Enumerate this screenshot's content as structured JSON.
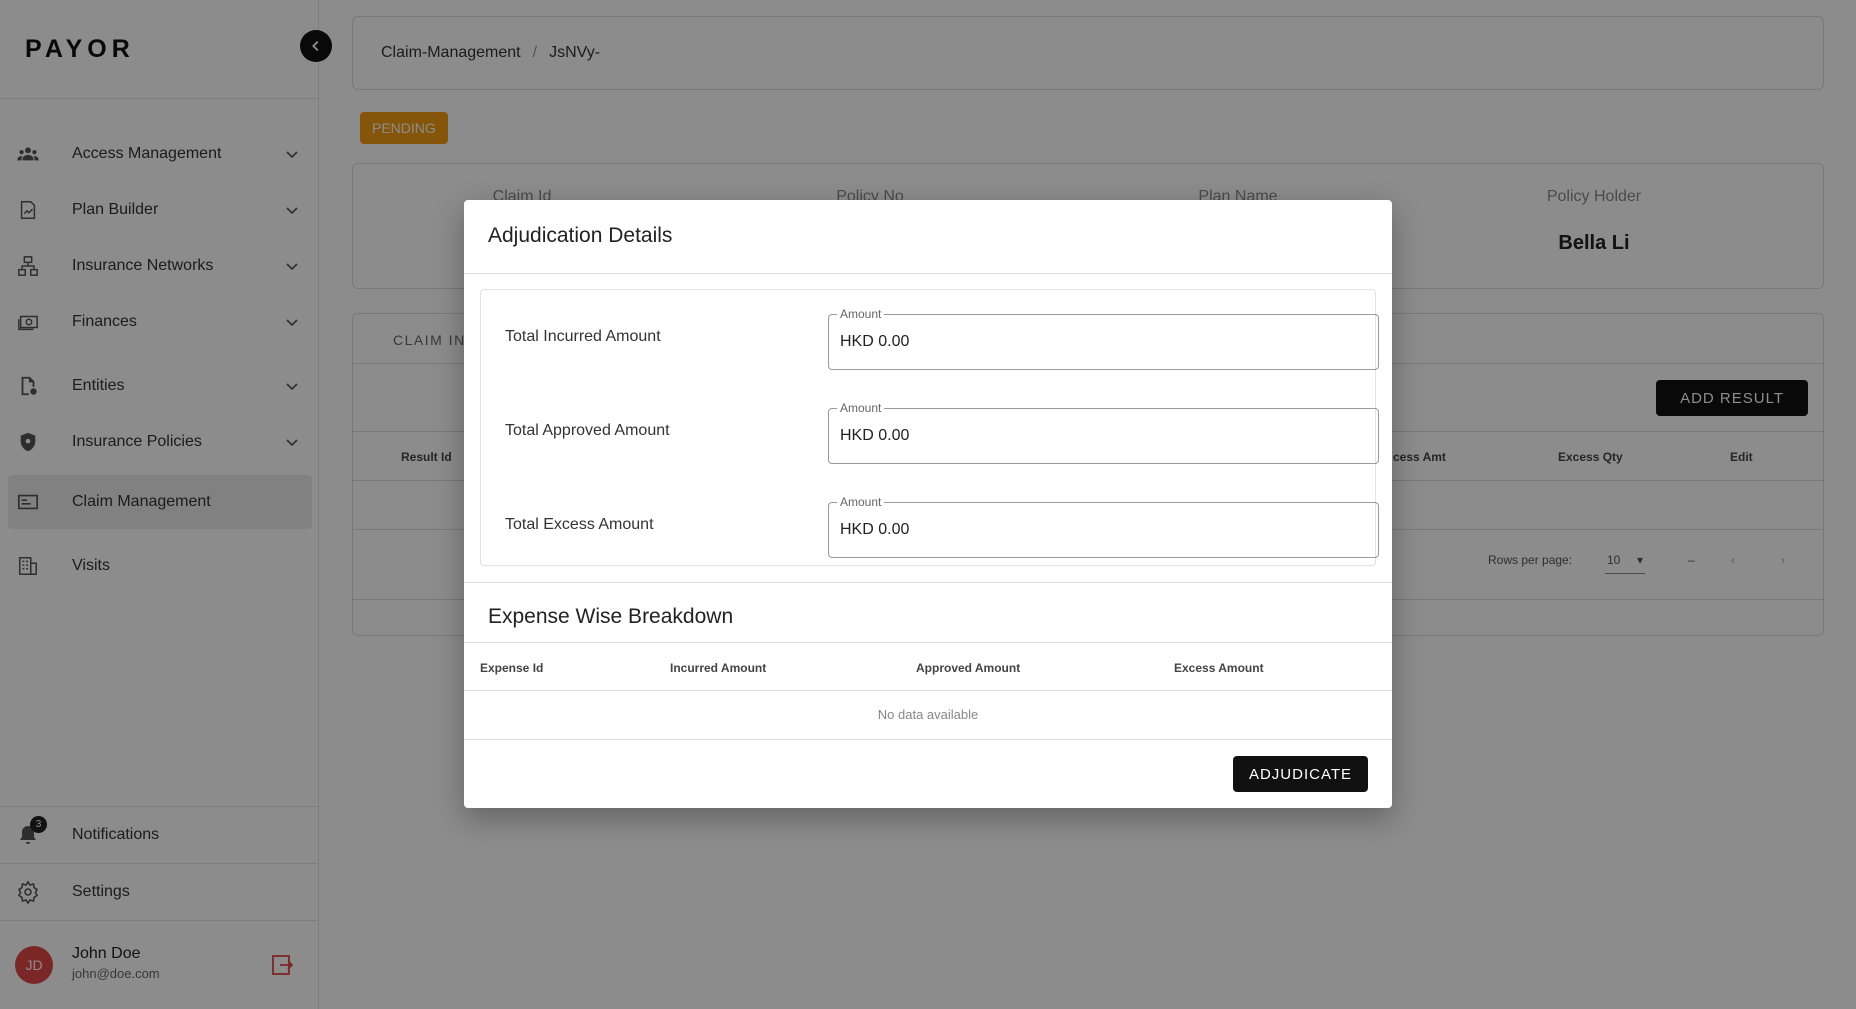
{
  "app": {
    "logo": "PAYOR"
  },
  "sidebar": {
    "items": [
      {
        "label": "Access Management",
        "icon": "users-icon"
      },
      {
        "label": "Plan Builder",
        "icon": "plan-icon"
      },
      {
        "label": "Insurance Networks",
        "icon": "network-icon"
      },
      {
        "label": "Finances",
        "icon": "money-icon"
      },
      {
        "label": "Entities",
        "icon": "entity-icon"
      },
      {
        "label": "Insurance Policies",
        "icon": "shield-icon"
      },
      {
        "label": "Claim Management",
        "icon": "card-icon",
        "active": true
      },
      {
        "label": "Visits",
        "icon": "building-icon"
      }
    ],
    "notifications": {
      "label": "Notifications",
      "count": "3"
    },
    "settings": {
      "label": "Settings"
    },
    "user": {
      "initials": "JD",
      "name": "John Doe",
      "email": "john@doe.com"
    }
  },
  "breadcrumb": {
    "first": "Claim-Management",
    "separator": "/",
    "second": "JsNVy-"
  },
  "status": {
    "label": "PENDING",
    "color": "#f39c12"
  },
  "info": {
    "claim_id_label": "Claim Id",
    "policy_no_label": "Policy No",
    "plan_name_label": "Plan Name",
    "policy_holder_label": "Policy Holder",
    "policy_holder_value": "Bella Li"
  },
  "tabs": {
    "active_label": "CLAIM IN"
  },
  "results": {
    "add_button": "ADD RESULT",
    "columns": {
      "result_id": "Result Id",
      "excess_amt": "cess Amt",
      "excess_qty": "Excess Qty",
      "edit": "Edit"
    },
    "pager": {
      "rows_label": "Rows per page:",
      "rows_value": "10",
      "range": "–"
    }
  },
  "modal": {
    "title": "Adjudication Details",
    "amounts": [
      {
        "label": "Total Incurred Amount",
        "legend": "Amount",
        "value": "HKD 0.00"
      },
      {
        "label": "Total Approved Amount",
        "legend": "Amount",
        "value": "HKD 0.00"
      },
      {
        "label": "Total Excess Amount",
        "legend": "Amount",
        "value": "HKD 0.00"
      }
    ],
    "breakdown_title": "Expense Wise Breakdown",
    "columns": {
      "expense_id": "Expense Id",
      "incurred": "Incurred Amount",
      "approved": "Approved Amount",
      "excess": "Excess Amount"
    },
    "empty_text": "No data available",
    "submit": "ADJUDICATE"
  }
}
